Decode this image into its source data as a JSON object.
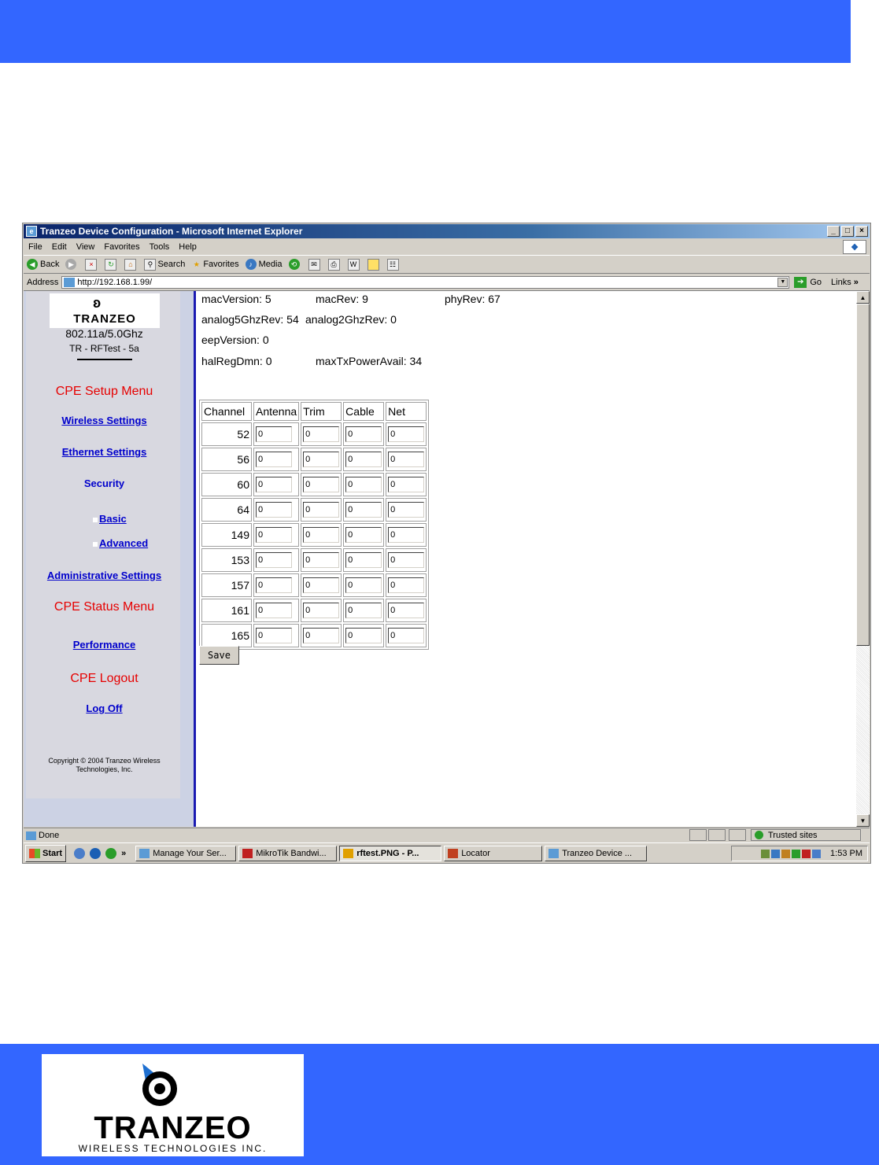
{
  "window": {
    "title": "Tranzeo Device Configuration - Microsoft Internet Explorer",
    "controls": [
      "_",
      "□",
      "×"
    ]
  },
  "menu": [
    "File",
    "Edit",
    "View",
    "Favorites",
    "Tools",
    "Help"
  ],
  "toolbar": {
    "back": "Back",
    "search": "Search",
    "favorites": "Favorites",
    "media": "Media"
  },
  "address": {
    "label": "Address",
    "url": "http://192.168.1.99/",
    "go": "Go",
    "links": "Links"
  },
  "sidebar": {
    "brand": "TRANZEO",
    "model": "802.11a/5.0Ghz",
    "device": "TR - RFTest - 5a",
    "setup_heading": "CPE Setup Menu",
    "wireless": "Wireless Settings",
    "ethernet": "Ethernet Settings",
    "security": "Security",
    "basic": "Basic",
    "advanced": "Advanced",
    "admin": "Administrative Settings",
    "status_heading": "CPE Status Menu",
    "performance": "Performance",
    "logout_heading": "CPE Logout",
    "logoff": "Log Off",
    "copyright": "Copyright © 2004 Tranzeo Wireless Technologies, Inc."
  },
  "info": {
    "mac_version": "macVersion: 5",
    "mac_rev": "macRev: 9",
    "phy_rev": "phyRev: 67",
    "analog5": "analog5GhzRev: 54",
    "analog2": "analog2GhzRev: 0",
    "eep": "eepVersion: 0",
    "hal": "halRegDmn: 0",
    "maxtx": "maxTxPowerAvail: 34"
  },
  "table": {
    "headers": [
      "Channel",
      "Antenna",
      "Trim",
      "Cable",
      "Net"
    ],
    "rows": [
      {
        "channel": "52",
        "antenna": "0",
        "trim": "0",
        "cable": "0",
        "net": "0"
      },
      {
        "channel": "56",
        "antenna": "0",
        "trim": "0",
        "cable": "0",
        "net": "0"
      },
      {
        "channel": "60",
        "antenna": "0",
        "trim": "0",
        "cable": "0",
        "net": "0"
      },
      {
        "channel": "64",
        "antenna": "0",
        "trim": "0",
        "cable": "0",
        "net": "0"
      },
      {
        "channel": "149",
        "antenna": "0",
        "trim": "0",
        "cable": "0",
        "net": "0"
      },
      {
        "channel": "153",
        "antenna": "0",
        "trim": "0",
        "cable": "0",
        "net": "0"
      },
      {
        "channel": "157",
        "antenna": "0",
        "trim": "0",
        "cable": "0",
        "net": "0"
      },
      {
        "channel": "161",
        "antenna": "0",
        "trim": "0",
        "cable": "0",
        "net": "0"
      },
      {
        "channel": "165",
        "antenna": "0",
        "trim": "0",
        "cable": "0",
        "net": "0"
      }
    ]
  },
  "save_label": "Save",
  "status": {
    "text": "Done",
    "zone": "Trusted sites"
  },
  "taskbar": {
    "start": "Start",
    "more": "»",
    "tasks": [
      "Manage Your Ser...",
      "MikroTik Bandwi...",
      "rftest.PNG - P...",
      "Locator",
      "Tranzeo Device ..."
    ],
    "clock": "1:53 PM"
  },
  "footer_logo": {
    "brand": "TRANZEO",
    "tagline": "WIRELESS TECHNOLOGIES INC."
  },
  "colors": {
    "band": "#3366ff",
    "link": "#0000cc",
    "heading_red": "#e60000"
  }
}
